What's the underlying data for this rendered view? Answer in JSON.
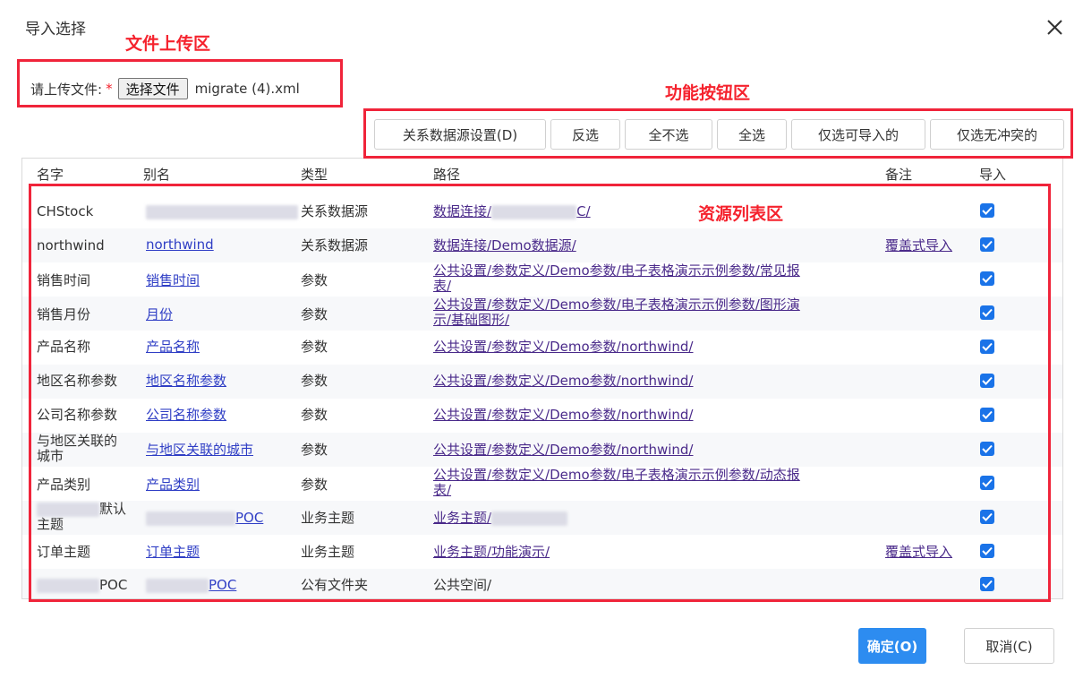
{
  "dialog": {
    "title": "导入选择",
    "close_icon": "close-icon"
  },
  "annotations": {
    "upload_area": "文件上传区",
    "button_area": "功能按钮区",
    "list_area": "资源列表区"
  },
  "upload": {
    "label": "请上传文件:",
    "required_mark": "*",
    "choose_button": "选择文件",
    "filename": "migrate (4).xml"
  },
  "toolbar": {
    "datasource_settings": "关系数据源设置(D)",
    "invert": "反选",
    "select_none": "全不选",
    "select_all": "全选",
    "select_importable": "仅选可导入的",
    "select_no_conflict": "仅选无冲突的"
  },
  "table": {
    "headers": {
      "name": "名字",
      "alias": "别名",
      "type": "类型",
      "path": "路径",
      "note": "备注",
      "import": "导入"
    },
    "rows": [
      {
        "name": "CHStock",
        "alias": "",
        "type": "关系数据源",
        "path1": "数据连接/",
        "path_tail": "C/",
        "note": "",
        "import": true
      },
      {
        "name": "northwind",
        "alias": "northwind",
        "type": "关系数据源",
        "path1": "数据连接/Demo数据源/",
        "note": "覆盖式导入",
        "import": true
      },
      {
        "name": "销售时间",
        "alias": "销售时间",
        "type": "参数",
        "path1": "公共设置/参数定义/Demo参数/电子表格演示示例参数/常见报",
        "path2": "表/",
        "note": "",
        "import": true
      },
      {
        "name": "销售月份",
        "alias": "月份",
        "type": "参数",
        "path1": "公共设置/参数定义/Demo参数/电子表格演示示例参数/图形演",
        "path2": "示/基础图形/",
        "note": "",
        "import": true
      },
      {
        "name": "产品名称",
        "alias": "产品名称",
        "type": "参数",
        "path1": "公共设置/参数定义/Demo参数/northwind/",
        "note": "",
        "import": true
      },
      {
        "name": "地区名称参数",
        "alias": "地区名称参数",
        "type": "参数",
        "path1": "公共设置/参数定义/Demo参数/northwind/",
        "note": "",
        "import": true
      },
      {
        "name": "公司名称参数",
        "alias": "公司名称参数",
        "type": "参数",
        "path1": "公共设置/参数定义/Demo参数/northwind/",
        "note": "",
        "import": true
      },
      {
        "name1": "与地区关联的",
        "name2": "城市",
        "alias": "与地区关联的城市",
        "type": "参数",
        "path1": "公共设置/参数定义/Demo参数/northwind/",
        "note": "",
        "import": true
      },
      {
        "name": "产品类别",
        "alias": "产品类别",
        "type": "参数",
        "path1": "公共设置/参数定义/Demo参数/电子表格演示示例参数/动态报",
        "path2": "表/",
        "note": "",
        "import": true
      },
      {
        "name1": "默认",
        "name2": "主题",
        "alias": "POC",
        "type": "业务主题",
        "path1": "业务主题/",
        "note": "",
        "import": true
      },
      {
        "name": "订单主题",
        "alias": "订单主题",
        "type": "业务主题",
        "path1": "业务主题/功能演示/",
        "note": "覆盖式导入",
        "import": true
      },
      {
        "name": "POC",
        "alias": "POC",
        "type": "公有文件夹",
        "path1": "公共空间/",
        "note": "",
        "import": true
      }
    ]
  },
  "footer": {
    "ok": "确定(O)",
    "cancel": "取消(C)"
  },
  "colors": {
    "accent": "#2d8cf0",
    "annotation_red": "#f0243a",
    "checkbox": "#1a73e8"
  }
}
